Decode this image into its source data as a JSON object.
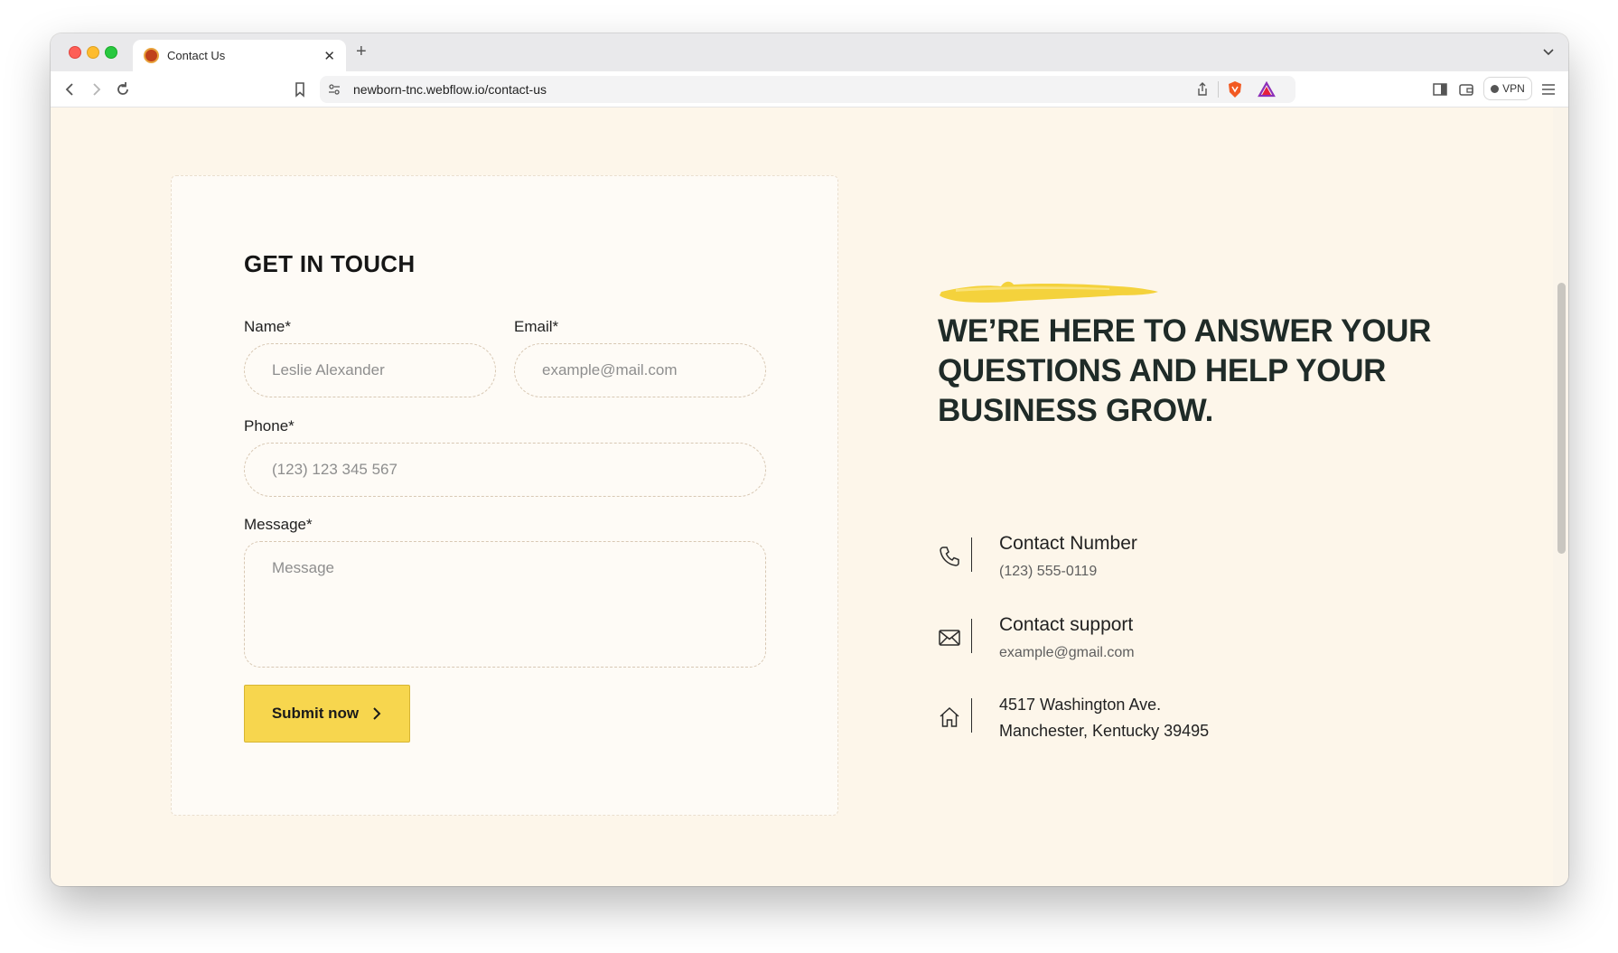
{
  "browser": {
    "tab_title": "Contact Us",
    "url": "newborn-tnc.webflow.io/contact-us",
    "vpn_label": "VPN"
  },
  "form": {
    "title": "GET IN TOUCH",
    "name_label": "Name*",
    "name_placeholder": "Leslie Alexander",
    "email_label": "Email*",
    "email_placeholder": "example@mail.com",
    "phone_label": "Phone*",
    "phone_placeholder": "(123) 123 345 567",
    "message_label": "Message*",
    "message_placeholder": "Message",
    "submit_label": "Submit now"
  },
  "info": {
    "headline": "WE’RE HERE TO ANSWER YOUR QUESTIONS AND HELP YOUR BUSINESS GROW.",
    "contact_number_title": "Contact Number",
    "contact_number_value": "(123) 555-0119",
    "support_title": "Contact support",
    "support_value": "example@gmail.com",
    "address_line1": "4517 Washington Ave.",
    "address_line2": "Manchester, Kentucky 39495"
  },
  "colors": {
    "page_background": "#fdf6ea",
    "accent_yellow": "#f7d64e",
    "headline_text": "#1f2b28"
  },
  "icons": [
    "phone-icon",
    "mail-icon",
    "home-icon",
    "back-icon",
    "forward-icon",
    "reload-icon",
    "bookmark-icon",
    "site-settings-icon",
    "share-icon",
    "brave-shield-icon",
    "brave-rewards-icon",
    "sidebar-icon",
    "wallet-icon",
    "menu-icon"
  ]
}
